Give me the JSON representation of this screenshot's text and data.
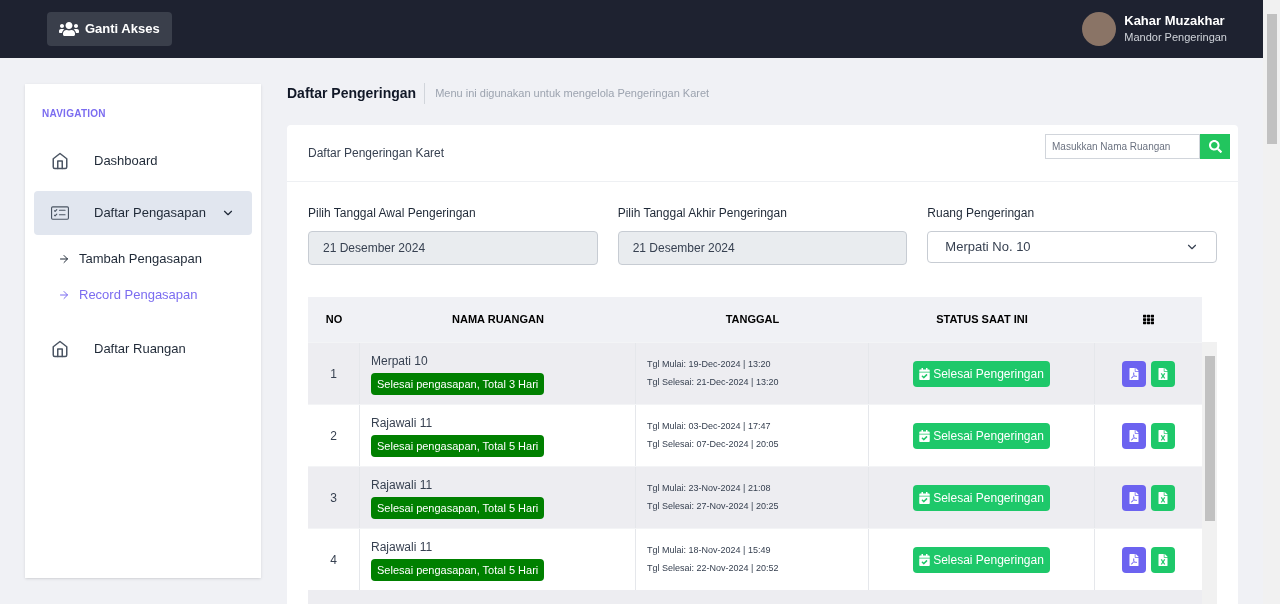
{
  "topbar": {
    "access_button": "Ganti Akses",
    "user": {
      "name": "Kahar Muzakhar",
      "role": "Mandor Pengeringan"
    }
  },
  "sidebar": {
    "heading": "NAVIGATION",
    "items": [
      {
        "label": "Dashboard",
        "kind": "home",
        "selected": false
      },
      {
        "label": "Daftar Pengasapan",
        "kind": "list",
        "selected": true,
        "expanded": true,
        "children": [
          {
            "label": "Tambah Pengasapan",
            "selected": false
          },
          {
            "label": "Record Pengasapan",
            "selected": true
          }
        ]
      },
      {
        "label": "Daftar Ruangan",
        "kind": "home",
        "selected": false
      }
    ]
  },
  "page": {
    "title": "Daftar Pengeringan",
    "subtitle": "Menu ini digunakan untuk mengelola Pengeringan Karet"
  },
  "card": {
    "title": "Daftar Pengeringan Karet",
    "search": {
      "placeholder": "Masukkan Nama Ruangan"
    },
    "filters": [
      {
        "label": "Pilih Tanggal Awal Pengeringan",
        "value": "21 Desember 2024",
        "kind": "date"
      },
      {
        "label": "Pilih Tanggal Akhir Pengeringan",
        "value": "21 Desember 2024",
        "kind": "date"
      },
      {
        "label": "Ruang Pengeringan",
        "value": "Merpati No. 10",
        "kind": "select"
      }
    ],
    "table": {
      "columns": [
        "NO",
        "NAMA RUANGAN",
        "TANGGAL",
        "STATUS SAAT INI"
      ],
      "rows": [
        {
          "no": "1",
          "name": "Merpati 10",
          "badge": "Selesai pengasapan, Total 3 Hari",
          "start": "Tgl Mulai: 19-Dec-2024 | 13:20",
          "end": "Tgl Selesai: 21-Dec-2024 | 13:20",
          "status": "Selesai Pengeringan"
        },
        {
          "no": "2",
          "name": "Rajawali 11",
          "badge": "Selesai pengasapan, Total 5 Hari",
          "start": "Tgl Mulai: 03-Dec-2024 | 17:47",
          "end": "Tgl Selesai: 07-Dec-2024 | 20:05",
          "status": "Selesai Pengeringan"
        },
        {
          "no": "3",
          "name": "Rajawali 11",
          "badge": "Selesai pengasapan, Total 5 Hari",
          "start": "Tgl Mulai: 23-Nov-2024 | 21:08",
          "end": "Tgl Selesai: 27-Nov-2024 | 20:25",
          "status": "Selesai Pengeringan"
        },
        {
          "no": "4",
          "name": "Rajawali 11",
          "badge": "Selesai pengasapan, Total 5 Hari",
          "start": "Tgl Mulai: 18-Nov-2024 | 15:49",
          "end": "Tgl Selesai: 22-Nov-2024 | 20:52",
          "status": "Selesai Pengeringan"
        }
      ]
    }
  }
}
